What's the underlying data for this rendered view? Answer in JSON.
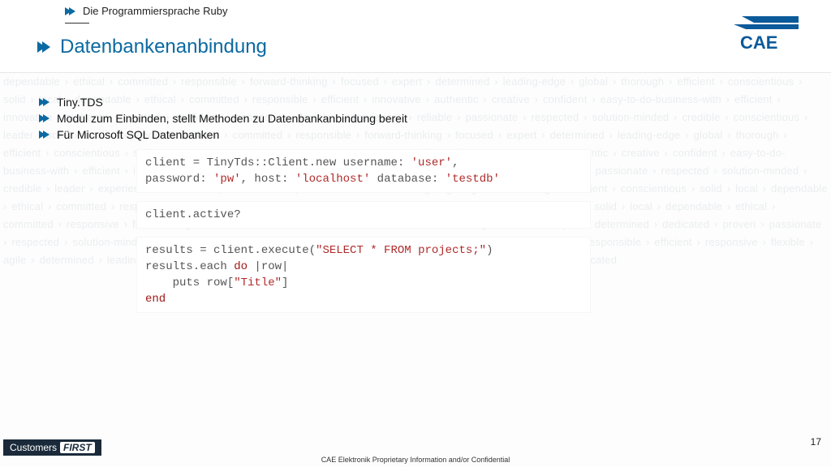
{
  "header": {
    "breadcrumb": "Die Programmiersprache Ruby",
    "title": "Datenbankenanbindung",
    "logo_text": "CAE"
  },
  "bullets": {
    "b1": "Tiny.TDS",
    "b2": "Modul zum Einbinden, stellt Methoden zu Datenbankanbindung bereit",
    "b3": "Für Microsoft SQL Datenbanken"
  },
  "code": {
    "block1_plain": "client = TinyTds::Client.new username: 'user',\npassword: 'pw', host: 'localhost' database: 'testdb'",
    "block2_plain": "client.active?",
    "block3_plain": "results = client.execute(\"SELECT * FROM projects;\")\nresults.each do |row|\n    puts row[\"Title\"]\nend"
  },
  "footer": {
    "badge_prefix": "Customers",
    "badge_em": "FIRST",
    "confidential": "CAE Elektronik Proprietary Information and/or Confidential",
    "page": "17"
  },
  "bg_words": "dependable › ethical › committed › responsible › forward-thinking › focused › expert › determined › leading-edge › global › thorough › efficient › conscientious › solid › local › dependable › ethical › committed › responsible › efficient › innovative › authentic › creative › confident › easy-to-do-business-with › efficient › innovative › authentic › creative › confident › responsive › flexible › experienced › reliable › passionate › respected › solution-minded › credible › conscientious › leader › solid › local › dependable › ethical › committed › responsible › forward-thinking › focused › expert › determined › leading-edge › global › thorough › efficient › conscientious › solid › local › dependable › ethical › committed › responsible › efficient › innovative › authentic › creative › confident › easy-to-do-business-with › efficient › innovative › authentic › creative › confident › responsive › flexible › experienced › reliable › passionate › respected › solution-minded › credible › leader › experienced › reliable › passionate › expert › determined › leading-edge › global › thorough › efficient › conscientious › solid › local › dependable › ethical › committed › responsible › forward-thinking › focused › solution-minded › credible › conscientious › leader › solid › local › dependable › ethical › committed › responsive › flexible › agile › conscientious › leader › solid › local › forward-thinking › focused › expert › determined › dedicated › proven › passionate › respected › solution-minded › credible › conscientious › leader › solid › local › dependable › ethical › committed › responsible › efficient › responsive › flexible › agile › determined › leading-edge › global › thorough › dedicated › easy-to-do-business-with › realistic › strong › dedicated"
}
